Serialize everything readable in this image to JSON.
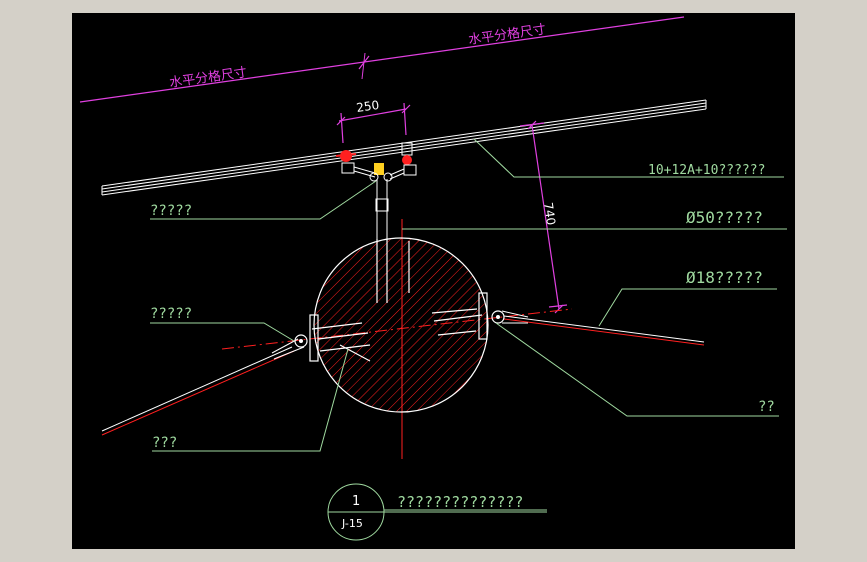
{
  "colors": {
    "background": "#000000",
    "frame": "#d4d0c8",
    "dimension": "#e040e0",
    "leader": "#9fd99f",
    "section": "#ff2020",
    "lines": "#ffffff"
  },
  "texts": {
    "grid_left": "水平分格尺寸",
    "grid_right": "水平分格尺寸",
    "dim_250": "250",
    "dim_740": "740",
    "label_glass": "10+12A+10??????",
    "label_top_left": "?????",
    "label_phi50": "Ø50?????",
    "label_phi18": "Ø18?????",
    "label_mid_left": "?????",
    "label_bottom_right": "??",
    "label_bottom_left": "???",
    "detail_number": "1",
    "detail_sheet": "J-15",
    "detail_title": "??????????????"
  }
}
